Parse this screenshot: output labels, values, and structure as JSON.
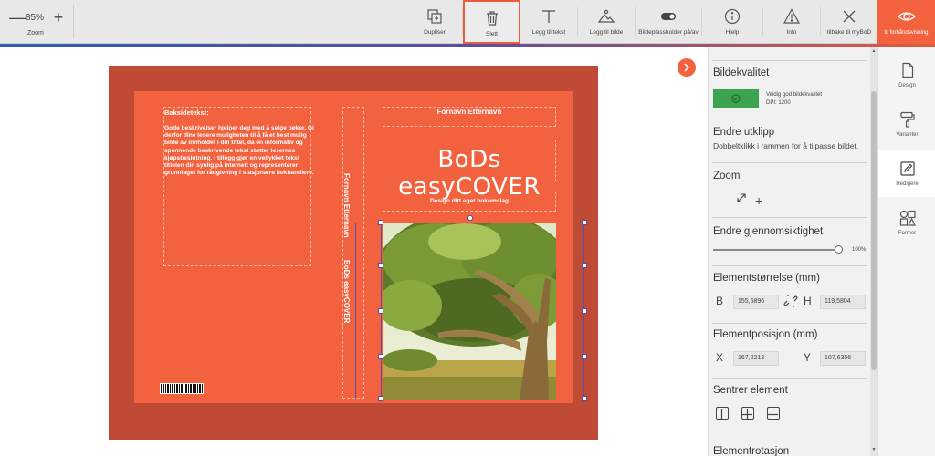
{
  "toolbar": {
    "zoom_value": "85%",
    "zoom_label": "Zoom",
    "buttons": [
      {
        "label": "Dupliser",
        "icon": "duplicate-icon"
      },
      {
        "label": "Slett",
        "icon": "trash-icon",
        "active": true
      },
      {
        "label": "Legg til tekst",
        "icon": "text-icon"
      },
      {
        "label": "Legg til bilde",
        "icon": "image-icon"
      },
      {
        "label": "Bildeplassholder på/av",
        "icon": "toggle-icon"
      },
      {
        "label": "Hjelp",
        "icon": "info-icon"
      },
      {
        "label": "Info",
        "icon": "warning-icon"
      },
      {
        "label": "tilbake til myBoD",
        "icon": "close-icon"
      }
    ],
    "preview_label": "til forhåndsvisning"
  },
  "cover": {
    "back_title": "Baksidetekst:",
    "back_text": "Gode beskrivelser hjelper deg med å selge bøker. Gi derfor dine lesere muligheten til å få et best mulig bilde av innholdet i din tittel, da en informativ og spennende beskrivende tekst støtter lesernes kjøpsbeslutning. I tillegg gjør en vellykket tekst tittelen din synlig på internett og representerer grunnlaget for rådgivning i stasjonære bokhandlere.",
    "spine_author": "Fornavn Etternavn",
    "spine_title": "BoDs easyCOVER",
    "front_author": "Fornavn Etternavn",
    "front_title": "BoDs easyCOVER",
    "front_subtitle": "Design ditt eget bokomslag"
  },
  "panel": {
    "quality_title": "Bildekvalitet",
    "quality_desc": "Veldig god bildekvalitet",
    "quality_dpi": "DPI: 1200",
    "crop_title": "Endre utklipp",
    "crop_note": "Dobbeltklikk i rammen for å tilpasse bildet.",
    "zoom_title": "Zoom",
    "zoom_minus": "—",
    "zoom_plus": "+",
    "opacity_title": "Endre gjennomsiktighet",
    "opacity_value": "100%",
    "opacity_fraction": 1.0,
    "size_title": "Elementstørrelse (mm)",
    "width_label": "B",
    "width_value": "155,6896",
    "height_label": "H",
    "height_value": "119,5804",
    "position_title": "Elementposisjon (mm)",
    "x_label": "X",
    "x_value": "167,2213",
    "y_label": "Y",
    "y_value": "107,6356",
    "center_title": "Sentrer element",
    "rotation_title": "Elementrotasjon"
  },
  "right_nav": [
    {
      "label": "Design",
      "icon": "document-icon"
    },
    {
      "label": "Varianter",
      "icon": "paint-roller-icon"
    },
    {
      "label": "Redigere",
      "icon": "edit-icon",
      "active": true
    },
    {
      "label": "Former",
      "icon": "shapes-icon"
    }
  ],
  "colors": {
    "accent": "#f3623f",
    "cover_dark": "#bf4a36",
    "quality_green": "#3da34f",
    "selection": "#5b4f9e"
  }
}
